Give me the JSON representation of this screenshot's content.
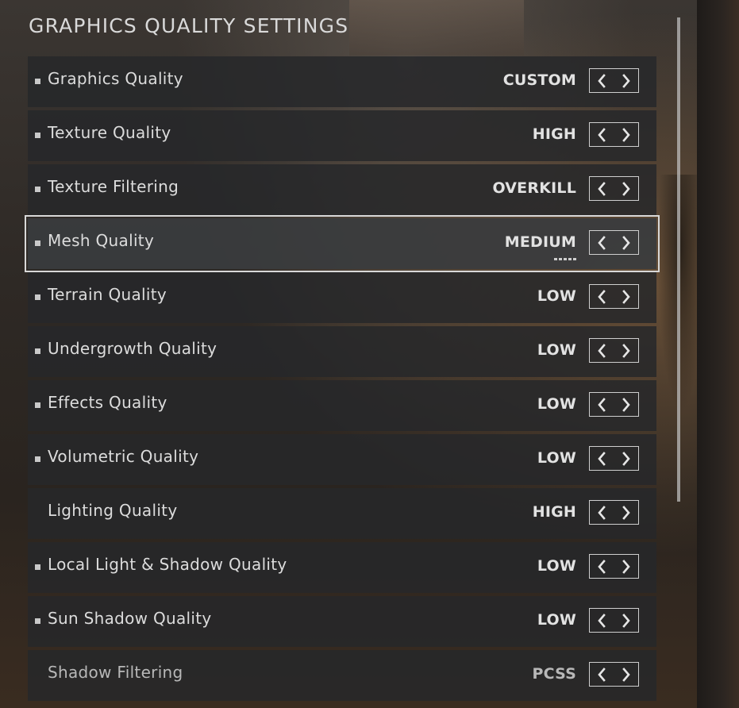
{
  "title": "GRAPHICS QUALITY SETTINGS",
  "settings": [
    {
      "label": "Graphics Quality",
      "value": "CUSTOM",
      "bullet": true
    },
    {
      "label": "Texture Quality",
      "value": "HIGH",
      "bullet": true
    },
    {
      "label": "Texture Filtering",
      "value": "OVERKILL",
      "bullet": true
    },
    {
      "label": "Mesh Quality",
      "value": "MEDIUM",
      "bullet": true,
      "selected": true
    },
    {
      "label": "Terrain Quality",
      "value": "LOW",
      "bullet": true
    },
    {
      "label": "Undergrowth Quality",
      "value": "LOW",
      "bullet": true
    },
    {
      "label": "Effects Quality",
      "value": "LOW",
      "bullet": true
    },
    {
      "label": "Volumetric Quality",
      "value": "LOW",
      "bullet": true
    },
    {
      "label": "Lighting Quality",
      "value": "HIGH",
      "bullet": false
    },
    {
      "label": "Local Light & Shadow Quality",
      "value": "LOW",
      "bullet": true
    },
    {
      "label": "Sun Shadow Quality",
      "value": "LOW",
      "bullet": true
    },
    {
      "label": "Shadow Filtering",
      "value": "PCSS",
      "bullet": false,
      "dim": true
    }
  ],
  "icons": {
    "decrease": "chevron-left-icon",
    "increase": "chevron-right-icon"
  },
  "colors": {
    "text": "#dcdcdc",
    "row_bg": "#26282a",
    "selected_outline": "#d8d8d8"
  }
}
